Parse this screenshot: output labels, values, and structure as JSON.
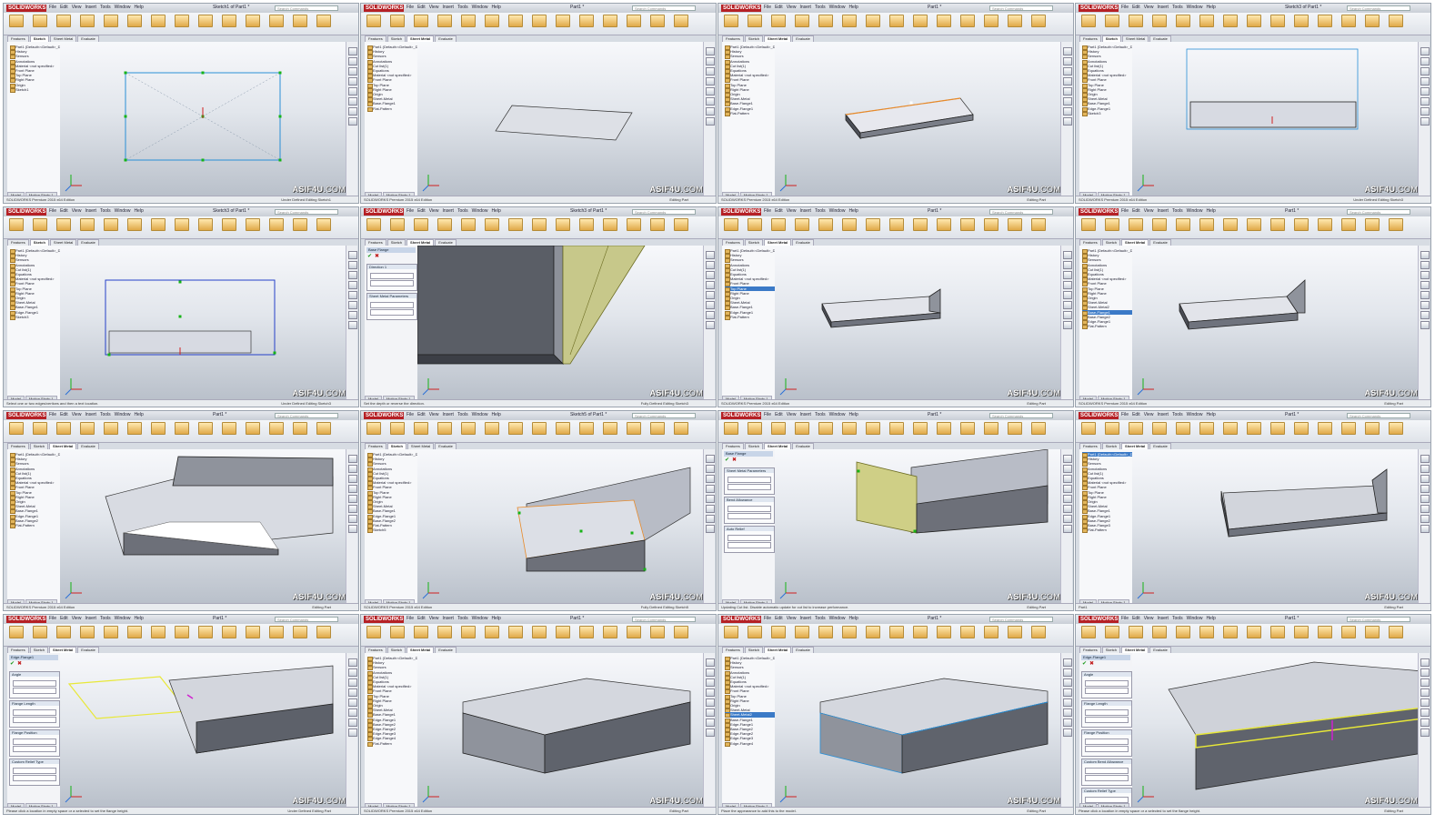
{
  "app": {
    "logo_text": "SOLIDWORKS",
    "menu_items": [
      "File",
      "Edit",
      "View",
      "Insert",
      "Tools",
      "Window",
      "Help"
    ],
    "search_placeholder": "Search Commands",
    "brand_color": "#b52025"
  },
  "tabs": [
    "Features",
    "Sketch",
    "Sheet Metal",
    "Evaluate"
  ],
  "watermark": {
    "main": "ASIF4U",
    "suffix": ".COM"
  },
  "tiles": [
    {
      "doc_title": "Sketch1 of Part1 *",
      "active_tab": "Sketch",
      "status_left": "SOLIDWORKS Premium 2015 x64 Edition",
      "status_right": "Under Defined   Editing Sketch1",
      "tree": [
        "Part1 (Default<<Default>_Dis",
        "History",
        "Sensors",
        "Annotations",
        "Material <not specified>",
        "Front Plane",
        "Top Plane",
        "Right Plane",
        "Origin",
        "Sketch1"
      ],
      "selected": -1
    },
    {
      "doc_title": "Part1 *",
      "active_tab": "Sheet Metal",
      "status_left": "SOLIDWORKS Premium 2015 x64 Edition",
      "status_right": "Editing Part",
      "tree": [
        "Part1 (Default<<Default>_Dis",
        "History",
        "Sensors",
        "Annotations",
        "Cut list(1)",
        "Equations",
        "Material <not specified>",
        "Front Plane",
        "Top Plane",
        "Right Plane",
        "Origin",
        "Sheet-Metal",
        "Base-Flange1",
        "Flat-Pattern"
      ],
      "selected": -1
    },
    {
      "doc_title": "Part1 *",
      "active_tab": "Sheet Metal",
      "status_left": "SOLIDWORKS Premium 2015 x64 Edition",
      "status_right": "Editing Part",
      "tree": [
        "Part1 (Default<<Default>_Dis",
        "History",
        "Sensors",
        "Annotations",
        "Cut list(1)",
        "Equations",
        "Material <not specified>",
        "Front Plane",
        "Top Plane",
        "Right Plane",
        "Origin",
        "Sheet-Metal",
        "Base-Flange1",
        "Edge-Flange1",
        "Flat-Pattern"
      ],
      "selected": -1
    },
    {
      "doc_title": "Sketch3 of Part1 *",
      "active_tab": "Sketch",
      "status_left": "SOLIDWORKS Premium 2015 x64 Edition",
      "status_right": "Under Defined   Editing Sketch3",
      "tree": [
        "Part1 (Default<<Default>_Dis",
        "History",
        "Sensors",
        "Annotations",
        "Cut list(1)",
        "Equations",
        "Material <not specified>",
        "Front Plane",
        "Top Plane",
        "Right Plane",
        "Origin",
        "Sheet-Metal",
        "Base-Flange1",
        "Edge-Flange1",
        "Sketch3"
      ],
      "selected": -1
    },
    {
      "doc_title": "Sketch3 of Part1 *",
      "active_tab": "Sketch",
      "status_left": "Select one or two edges/vertices and then a text location.",
      "status_right": "Under Defined   Editing Sketch3",
      "tree": [
        "Part1 (Default<<Default>_Dis",
        "History",
        "Sensors",
        "Annotations",
        "Cut list(1)",
        "Equations",
        "Material <not specified>",
        "Front Plane",
        "Top Plane",
        "Right Plane",
        "Origin",
        "Sheet-Metal",
        "Base-Flange1",
        "Edge-Flange1",
        "Sketch3"
      ],
      "selected": -1
    },
    {
      "doc_title": "Sketch3 of Part1 *",
      "active_tab": "Sheet Metal",
      "status_left": "Set the depth or reverse the direction.",
      "status_right": "Fully Defined   Editing Sketch3",
      "pm": {
        "title": "Base Flange",
        "sections": [
          "Direction 1",
          "Sheet Metal Parameters"
        ]
      }
    },
    {
      "doc_title": "Part1 *",
      "active_tab": "Sheet Metal",
      "status_left": "SOLIDWORKS Premium 2015 x64 Edition",
      "status_right": "Editing Part",
      "tree": [
        "Part1 (Default<<Default>_Dis",
        "History",
        "Sensors",
        "Annotations",
        "Cut list(1)",
        "Equations",
        "Material <not specified>",
        "Front Plane",
        "Top Plane",
        "Right Plane",
        "Origin",
        "Sheet-Metal",
        "Base-Flange1",
        "Edge-Flange1",
        "Flat-Pattern"
      ],
      "selected": 8
    },
    {
      "doc_title": "Part1 *",
      "active_tab": "Sheet Metal",
      "status_left": "SOLIDWORKS Premium 2015 x64 Edition",
      "status_right": "Editing Part",
      "tree": [
        "Part1 (Default<<Default>_Dis",
        "History",
        "Sensors",
        "Annotations",
        "Cut list(1)",
        "Equations",
        "Material <not specified>",
        "Front Plane",
        "Top Plane",
        "Right Plane",
        "Origin",
        "Sheet-Metal",
        "Sheet-Metal2",
        "Base-Flange1",
        "Base-Flange2",
        "Edge-Flange1",
        "Flat-Pattern"
      ],
      "selected": 13
    },
    {
      "doc_title": "Part1 *",
      "active_tab": "Sheet Metal",
      "status_left": "SOLIDWORKS Premium 2015 x64 Edition",
      "status_right": "Editing Part",
      "tree": [
        "Part1 (Default<<Default>_Dis",
        "History",
        "Sensors",
        "Annotations",
        "Cut list(1)",
        "Equations",
        "Material <not specified>",
        "Front Plane",
        "Top Plane",
        "Right Plane",
        "Origin",
        "Sheet-Metal",
        "Base-Flange1",
        "Edge-Flange1",
        "Base-Flange2",
        "Flat-Pattern"
      ],
      "selected": -1
    },
    {
      "doc_title": "Sketch5 of Part1 *",
      "active_tab": "Sketch",
      "status_left": "SOLIDWORKS Premium 2015 x64 Edition",
      "status_right": "Fully Defined   Editing Sketch5",
      "tree": [
        "Part1 (Default<<Default>_Dis",
        "History",
        "Sensors",
        "Annotations",
        "Cut list(1)",
        "Equations",
        "Material <not specified>",
        "Front Plane",
        "Top Plane",
        "Right Plane",
        "Origin",
        "Sheet-Metal",
        "Base-Flange1",
        "Edge-Flange1",
        "Base-Flange2",
        "Flat-Pattern",
        "Sketch5"
      ],
      "selected": -1
    },
    {
      "doc_title": "Part1 *",
      "active_tab": "Sheet Metal",
      "status_left": "Updating Cut list. Disable automatic update for cut list to increase performance.",
      "status_right": "Editing Part",
      "pm": {
        "title": "Base Flange",
        "sections": [
          "Sheet Metal Parameters",
          "Bend Allowance",
          "Auto Relief"
        ]
      }
    },
    {
      "doc_title": "Part1 *",
      "active_tab": "Sheet Metal",
      "status_left": "Part1",
      "status_right": "Editing Part",
      "tree": [
        "Part1 (Default<<Default>_Dis",
        "History",
        "Sensors",
        "Annotations",
        "Cut list(1)",
        "Equations",
        "Material <not specified>",
        "Front Plane",
        "Top Plane",
        "Right Plane",
        "Origin",
        "Sheet-Metal",
        "Base-Flange1",
        "Edge-Flange1",
        "Base-Flange2",
        "Base-Flange3",
        "Flat-Pattern"
      ],
      "selected": 0
    },
    {
      "doc_title": "Part1 *",
      "active_tab": "Sheet Metal",
      "status_left": "Please click a location in empty space or a selected to set the flange height.",
      "status_right": "Under Defined   Editing Part",
      "pm": {
        "title": "Edge-Flange1",
        "sections": [
          "Angle",
          "Flange Length",
          "Flange Position",
          "Custom Relief Type"
        ]
      }
    },
    {
      "doc_title": "Part1 *",
      "active_tab": "Sheet Metal",
      "status_left": "SOLIDWORKS Premium 2015 x64 Edition",
      "status_right": "Editing Part",
      "tree": [
        "Part1 (Default<<Default>_Dis",
        "History",
        "Sensors",
        "Annotations",
        "Cut list(1)",
        "Equations",
        "Material <not specified>",
        "Front Plane",
        "Top Plane",
        "Right Plane",
        "Origin",
        "Sheet-Metal",
        "Base-Flange1",
        "Edge-Flange1",
        "Base-Flange2",
        "Edge-Flange2",
        "Edge-Flange3",
        "Edge-Flange4",
        "Flat-Pattern"
      ],
      "selected": -1
    },
    {
      "doc_title": "Part1 *",
      "active_tab": "Sheet Metal",
      "status_left": "Place the appearance to add this to the model.",
      "status_right": "Editing Part",
      "tree": [
        "Part1 (Default<<Default>_Dis",
        "History",
        "Sensors",
        "Annotations",
        "Cut list(1)",
        "Equations",
        "Material <not specified>",
        "Front Plane",
        "Top Plane",
        "Right Plane",
        "Origin",
        "Sheet-Metal",
        "Sheet-Metal2",
        "Base-Flange1",
        "Edge-Flange1",
        "Base-Flange2",
        "Edge-Flange2",
        "Edge-Flange3",
        "Edge-Flange4"
      ],
      "selected": 12
    },
    {
      "doc_title": "Part1 *",
      "active_tab": "Sheet Metal",
      "status_left": "Please click a location in empty space or a selected to set the flange height.",
      "status_right": "Editing Part",
      "pm": {
        "title": "Edge-Flange1",
        "sections": [
          "Angle",
          "Flange Length",
          "Flange Position",
          "Custom Bend Allowance",
          "Custom Relief Type"
        ]
      }
    }
  ]
}
